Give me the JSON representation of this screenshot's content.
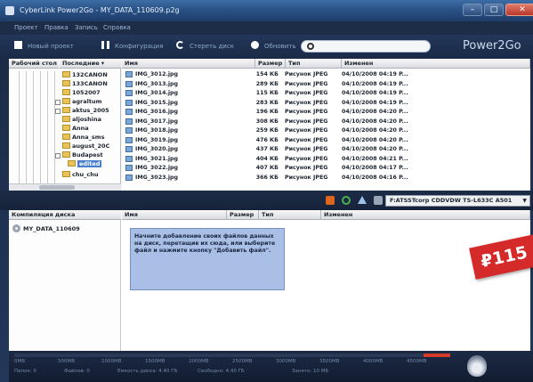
{
  "window": {
    "title": "CyberLink Power2Go - MY_DATA_110609.p2g"
  },
  "menu": [
    "Проект",
    "Правка",
    "Запись",
    "Справка"
  ],
  "toolbar": {
    "new_project": "Новый проект",
    "configuration": "Конфигурация",
    "erase_disc": "Стереть диск",
    "update": "Обновить",
    "search_placeholder": "",
    "brand": "Power2Go"
  },
  "tree": {
    "headers": [
      "Рабочий стол",
      "Последние"
    ],
    "items": [
      "132CANON",
      "133CANON",
      "1052007",
      "agraltum",
      "aktus_2005",
      "aljoshina",
      "Anna",
      "Anna_sms",
      "august_20C",
      "Budapest",
      "edited",
      "chu_chu"
    ]
  },
  "files": {
    "columns": [
      "Имя",
      "Размер",
      "Тип",
      "Изменен"
    ],
    "rows": [
      {
        "name": "IMG_3012.jpg",
        "size": "154 КБ",
        "type": "Рисунок JPEG",
        "date": "04/10/2008 04:19 P..."
      },
      {
        "name": "IMG_3013.jpg",
        "size": "289 КБ",
        "type": "Рисунок JPEG",
        "date": "04/10/2008 04:19 P..."
      },
      {
        "name": "IMG_3014.jpg",
        "size": "115 КБ",
        "type": "Рисунок JPEG",
        "date": "04/10/2008 04:19 P..."
      },
      {
        "name": "IMG_3015.jpg",
        "size": "283 КБ",
        "type": "Рисунок JPEG",
        "date": "04/10/2008 04:19 P..."
      },
      {
        "name": "IMG_3016.jpg",
        "size": "196 КБ",
        "type": "Рисунок JPEG",
        "date": "04/10/2008 04:20 P..."
      },
      {
        "name": "IMG_3017.jpg",
        "size": "308 КБ",
        "type": "Рисунок JPEG",
        "date": "04/10/2008 04:20 P..."
      },
      {
        "name": "IMG_3018.jpg",
        "size": "259 КБ",
        "type": "Рисунок JPEG",
        "date": "04/10/2008 04:20 P..."
      },
      {
        "name": "IMG_3019.jpg",
        "size": "476 КБ",
        "type": "Рисунок JPEG",
        "date": "04/10/2008 04:20 P..."
      },
      {
        "name": "IMG_3020.jpg",
        "size": "437 КБ",
        "type": "Рисунок JPEG",
        "date": "04/10/2008 04:20 P..."
      },
      {
        "name": "IMG_3021.jpg",
        "size": "404 КБ",
        "type": "Рисунок JPEG",
        "date": "04/10/2008 04:21 P..."
      },
      {
        "name": "IMG_3022.jpg",
        "size": "407 КБ",
        "type": "Рисунок JPEG",
        "date": "04/10/2008 04:17 P..."
      },
      {
        "name": "IMG_3023.jpg",
        "size": "366 КБ",
        "type": "Рисунок JPEG",
        "date": "04/10/2008 04:16 P..."
      }
    ]
  },
  "burner": {
    "drive": "F:ATSSTcorp CDDVDW TS-L633C A501"
  },
  "compilation": {
    "header": "Компиляция диска",
    "item": "MY_DATA_110609",
    "columns": [
      "Имя",
      "Размер",
      "Тип",
      "Изменен"
    ],
    "hint": "Начните добавление своих файлов данных на диск, перетащив их сюда, или выберите файл и нажмите кнопку \"Добавить файл\"."
  },
  "price": "₽115",
  "capacity": {
    "ticks": [
      "0MB",
      "500MB",
      "1000MB",
      "1500MB",
      "2000MB",
      "2500MB",
      "3000MB",
      "3500MB",
      "4000MB",
      "4500MB"
    ],
    "stats": [
      "Папок: 0",
      "Файлов: 0",
      "Емкость диска: 4.40 ГБ",
      "Свободно: 4.40 ГБ",
      "Занято: 10 МБ"
    ]
  },
  "colors": {
    "accent": "#2a5286",
    "selection": "#4a7fd0",
    "hint_bg": "#a9bfe6",
    "price_tag": "#d42a2a",
    "capacity_red": "#d83a2a"
  }
}
